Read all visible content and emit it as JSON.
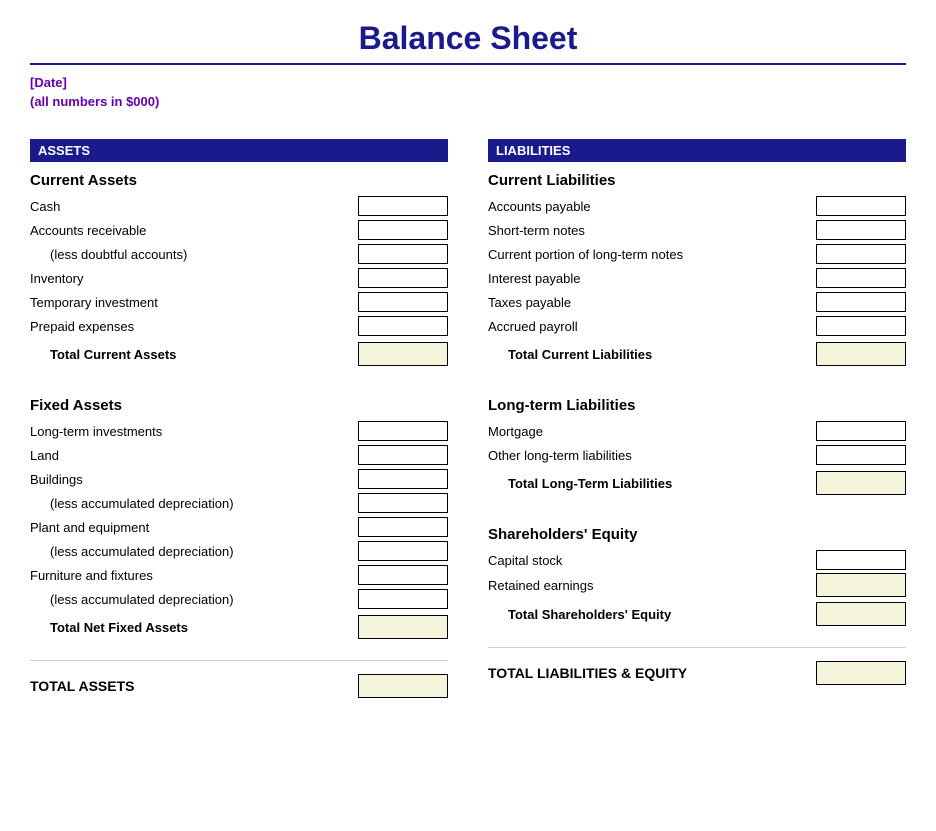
{
  "title": "Balance Sheet",
  "subtitle1": "[Date]",
  "subtitle2": "(all numbers in $000)",
  "assets": {
    "header": "ASSETS",
    "current": {
      "title": "Current Assets",
      "items": [
        {
          "label": "Cash",
          "indent": false
        },
        {
          "label": "Accounts receivable",
          "indent": false
        },
        {
          "label": "(less doubtful accounts)",
          "indent": true
        },
        {
          "label": "Inventory",
          "indent": false
        },
        {
          "label": "Temporary investment",
          "indent": false
        },
        {
          "label": "Prepaid expenses",
          "indent": false
        }
      ],
      "total_label": "Total Current Assets"
    },
    "fixed": {
      "title": "Fixed Assets",
      "items": [
        {
          "label": "Long-term investments",
          "indent": false
        },
        {
          "label": "Land",
          "indent": false
        },
        {
          "label": "Buildings",
          "indent": false
        },
        {
          "label": "(less accumulated depreciation)",
          "indent": true
        },
        {
          "label": "Plant and equipment",
          "indent": false
        },
        {
          "label": "(less accumulated depreciation)",
          "indent": true
        },
        {
          "label": "Furniture and fixtures",
          "indent": false
        },
        {
          "label": "(less accumulated depreciation)",
          "indent": true
        }
      ],
      "total_label": "Total Net Fixed Assets"
    },
    "grand_total_label": "TOTAL ASSETS"
  },
  "liabilities": {
    "header": "LIABILITIES",
    "current": {
      "title": "Current Liabilities",
      "items": [
        {
          "label": "Accounts payable",
          "indent": false
        },
        {
          "label": "Short-term notes",
          "indent": false
        },
        {
          "label": "Current portion of long-term notes",
          "indent": false
        },
        {
          "label": "Interest payable",
          "indent": false
        },
        {
          "label": "Taxes payable",
          "indent": false
        },
        {
          "label": "Accrued payroll",
          "indent": false
        }
      ],
      "total_label": "Total Current Liabilities"
    },
    "longterm": {
      "title": "Long-term Liabilities",
      "items": [
        {
          "label": "Mortgage",
          "indent": false
        },
        {
          "label": "Other long-term liabilities",
          "indent": false
        }
      ],
      "total_label": "Total Long-Term Liabilities"
    },
    "equity": {
      "title": "Shareholders' Equity",
      "items": [
        {
          "label": "Capital stock",
          "indent": false
        },
        {
          "label": "Retained earnings",
          "indent": false
        }
      ],
      "total_label": "Total Shareholders' Equity"
    },
    "grand_total_label": "TOTAL LIABILITIES & EQUITY"
  }
}
